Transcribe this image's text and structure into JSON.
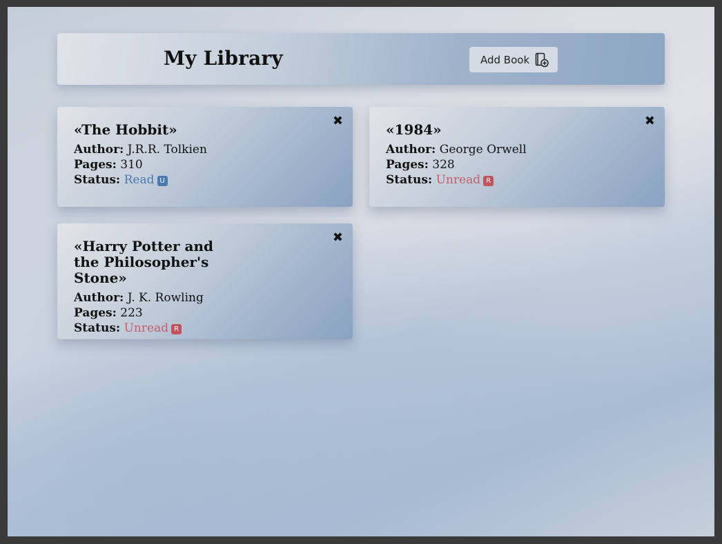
{
  "header": {
    "title": "My Library",
    "add_button_label": "Add Book",
    "add_button_icon": "add-book-icon"
  },
  "labels": {
    "author": "Author:",
    "pages": "Pages:",
    "status": "Status:",
    "close_glyph": "✖"
  },
  "books": [
    {
      "title": "«The Hobbit»",
      "author": "J.R.R. Tolkien",
      "pages": "310",
      "status": "Read",
      "toggle": "U"
    },
    {
      "title": "«1984»",
      "author": "George Orwell",
      "pages": "328",
      "status": "Unread",
      "toggle": "R"
    },
    {
      "title": "«Harry Potter and the Philosopher's Stone»",
      "author": "J. K. Rowling",
      "pages": "223",
      "status": "Unread",
      "toggle": "R"
    }
  ],
  "colors": {
    "read": "#4a78b0",
    "unread": "#c4606a"
  }
}
